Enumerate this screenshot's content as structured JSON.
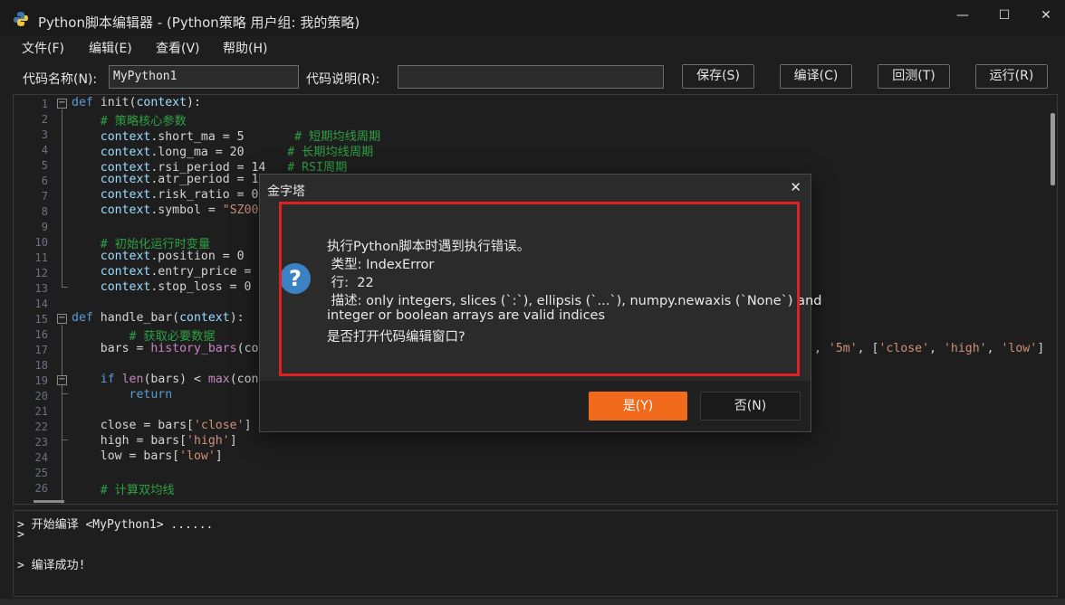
{
  "window": {
    "title": "Python脚本编辑器 - (Python策略 用户组: 我的策略)",
    "minimize_glyph": "—",
    "maximize_glyph": "☐",
    "close_glyph": "✕"
  },
  "menu": [
    "文件(F)",
    "编辑(E)",
    "查看(V)",
    "帮助(H)"
  ],
  "toolbar": {
    "name_label": "代码名称(N):",
    "name_value": "MyPython1",
    "desc_label": "代码说明(R):",
    "desc_value": "",
    "buttons": [
      "保存(S)",
      "编译(C)",
      "回测(T)",
      "运行(R)"
    ]
  },
  "editor": {
    "line_numbers": [
      "1",
      "2",
      "3",
      "4",
      "5",
      "6",
      "7",
      "8",
      "9",
      "10",
      "11",
      "12",
      "13",
      "14",
      "15",
      "16",
      "17",
      "18",
      "19",
      "20",
      "21",
      "22",
      "23",
      "24",
      "25",
      "26"
    ],
    "code": {
      "l1": [
        "def",
        " init(",
        "context",
        "):"
      ],
      "l2": "    # 策略核心参数",
      "l3": [
        "    context",
        ".short_ma = 5       ",
        "# 短期均线周期"
      ],
      "l4": [
        "    context",
        ".long_ma = 20      ",
        "# 长期均线周期"
      ],
      "l5": [
        "    context",
        ".rsi_period = 14   ",
        "# RSI周期"
      ],
      "l6": [
        "    context",
        ".atr_period = 1"
      ],
      "l7": [
        "    context",
        ".risk_ratio = 0"
      ],
      "l8": [
        "    context",
        ".symbol = ",
        "\"SZ00"
      ],
      "l10": "    # 初始化运行时变量",
      "l11": [
        "    context",
        ".position = 0"
      ],
      "l12": [
        "    context",
        ".entry_price = "
      ],
      "l13": [
        "    context",
        ".stop_loss = 0"
      ],
      "l15": [
        "def",
        " handle_bar(",
        "context",
        "):"
      ],
      "l16": "        # 获取必要数据",
      "l17": [
        "    bars = ",
        "history_bars",
        "(co"
      ],
      "l17_tail": [
        ", ",
        "'5m'",
        ", [",
        "'close'",
        ", ",
        "'high'",
        ", ",
        "'low'",
        "]"
      ],
      "l19": [
        "    ",
        "if",
        " ",
        "len",
        "(bars) < ",
        "max",
        "(con"
      ],
      "l20": [
        "        ",
        "return"
      ],
      "l22": [
        "    close = bars[",
        "'close'",
        "]"
      ],
      "l23": [
        "    high = bars[",
        "'high'",
        "]"
      ],
      "l24": [
        "    low = bars[",
        "'low'",
        "]"
      ],
      "l26": "    # 计算双均线"
    }
  },
  "output": {
    "lines": [
      "> 开始编译 <MyPython1> ......",
      ">",
      "",
      "> 编译成功!"
    ]
  },
  "dialog": {
    "title": "金字塔",
    "close_glyph": "✕",
    "icon": "question-icon",
    "icon_glyph": "?",
    "message": [
      "执行Python脚本时遇到执行错误。",
      " 类型: IndexError",
      " 行:  22",
      " 描述: only integers, slices (`:`), ellipsis (`...`), numpy.newaxis (`None`) and",
      "integer or boolean arrays are valid indices",
      "是否打开代码编辑窗口?"
    ],
    "yes_label": "是(Y)",
    "no_label": "否(N)"
  },
  "colors": {
    "background": "#1e1e1e",
    "keyword": "#569cd6",
    "comment": "#2ea043",
    "string": "#ce9178",
    "primary_button": "#f26b1d",
    "highlight_border": "#e02020"
  }
}
